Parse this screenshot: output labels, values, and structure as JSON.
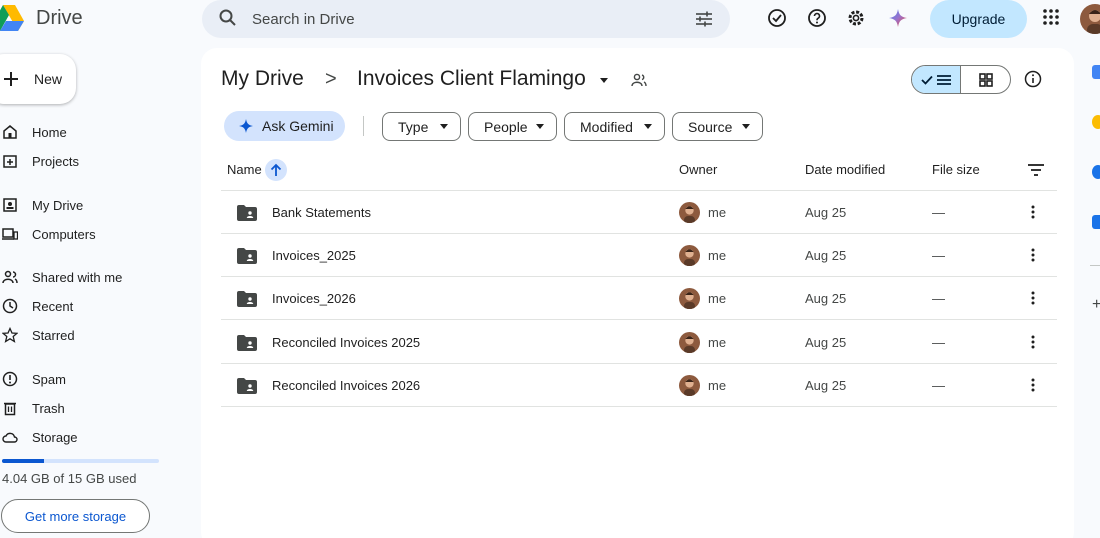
{
  "header": {
    "app_name": "Drive",
    "search_placeholder": "Search in Drive",
    "upgrade_label": "Upgrade"
  },
  "sidebar": {
    "new_label": "New",
    "items": [
      {
        "label": "Home",
        "icon": "home-icon"
      },
      {
        "label": "Projects",
        "icon": "projects-icon"
      },
      {
        "label": "My Drive",
        "icon": "my-drive-icon"
      },
      {
        "label": "Computers",
        "icon": "computers-icon"
      },
      {
        "label": "Shared with me",
        "icon": "shared-icon"
      },
      {
        "label": "Recent",
        "icon": "clock-icon"
      },
      {
        "label": "Starred",
        "icon": "star-icon"
      },
      {
        "label": "Spam",
        "icon": "spam-icon"
      },
      {
        "label": "Trash",
        "icon": "trash-icon"
      },
      {
        "label": "Storage",
        "icon": "cloud-icon"
      }
    ],
    "storage_used_fraction": 0.27,
    "storage_text": "4.04 GB of 15 GB used",
    "get_storage_label": "Get more storage"
  },
  "breadcrumb": {
    "root": "My Drive",
    "separator": ">",
    "current": "Invoices Client Flamingo"
  },
  "filters": {
    "gemini_label": "Ask Gemini",
    "chips": [
      "Type",
      "People",
      "Modified",
      "Source"
    ]
  },
  "table": {
    "columns": {
      "name": "Name",
      "owner": "Owner",
      "date": "Date modified",
      "size": "File size"
    },
    "rows": [
      {
        "name": "Bank Statements",
        "owner": "me",
        "date": "Aug 25",
        "size": "—"
      },
      {
        "name": "Invoices_2025",
        "owner": "me",
        "date": "Aug 25",
        "size": "—"
      },
      {
        "name": "Invoices_2026",
        "owner": "me",
        "date": "Aug 25",
        "size": "—"
      },
      {
        "name": "Reconciled Invoices 2025",
        "owner": "me",
        "date": "Aug 25",
        "size": "—"
      },
      {
        "name": "Reconciled Invoices 2026",
        "owner": "me",
        "date": "Aug 25",
        "size": "—"
      }
    ]
  },
  "colors": {
    "accent": "#0b57d0",
    "selected_bg": "#c2e7ff",
    "chip_bg": "#d3e3fd"
  }
}
